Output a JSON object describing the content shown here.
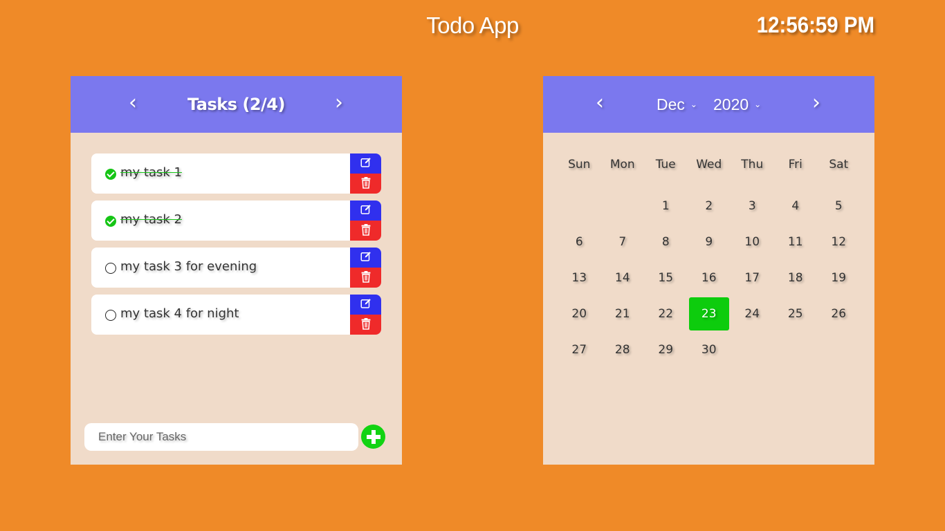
{
  "header": {
    "title": "Todo App",
    "clock": "12:56:59 PM"
  },
  "tasks": {
    "title": "Tasks (2/4)",
    "prev_icon": "chevron-left-icon",
    "next_icon": "chevron-right-icon",
    "items": [
      {
        "text": "my task 1",
        "done": true
      },
      {
        "text": "my task 2",
        "done": true
      },
      {
        "text": "my task 3 for evening",
        "done": false
      },
      {
        "text": "my task 4 for night",
        "done": false
      }
    ],
    "input_placeholder": "Enter Your Tasks",
    "colors": {
      "edit": "#3030ee",
      "delete": "#ef2a2a",
      "done": "#16c516",
      "add": "#12d312"
    }
  },
  "calendar": {
    "month": "Dec",
    "year": "2020",
    "weekdays": [
      "Sun",
      "Mon",
      "Tue",
      "Wed",
      "Thu",
      "Fri",
      "Sat"
    ],
    "days": [
      "1",
      "2",
      "3",
      "4",
      "5",
      "6",
      "7",
      "8",
      "9",
      "10",
      "11",
      "12",
      "13",
      "14",
      "15",
      "16",
      "17",
      "18",
      "19",
      "20",
      "21",
      "22",
      "23",
      "24",
      "25",
      "26",
      "27",
      "28",
      "29",
      "30"
    ],
    "selected_day": "23",
    "colors": {
      "header": "#7b78ee",
      "selected": "#0dcc0d",
      "body": "#f0dbc9",
      "page": "#ef8a28"
    }
  }
}
